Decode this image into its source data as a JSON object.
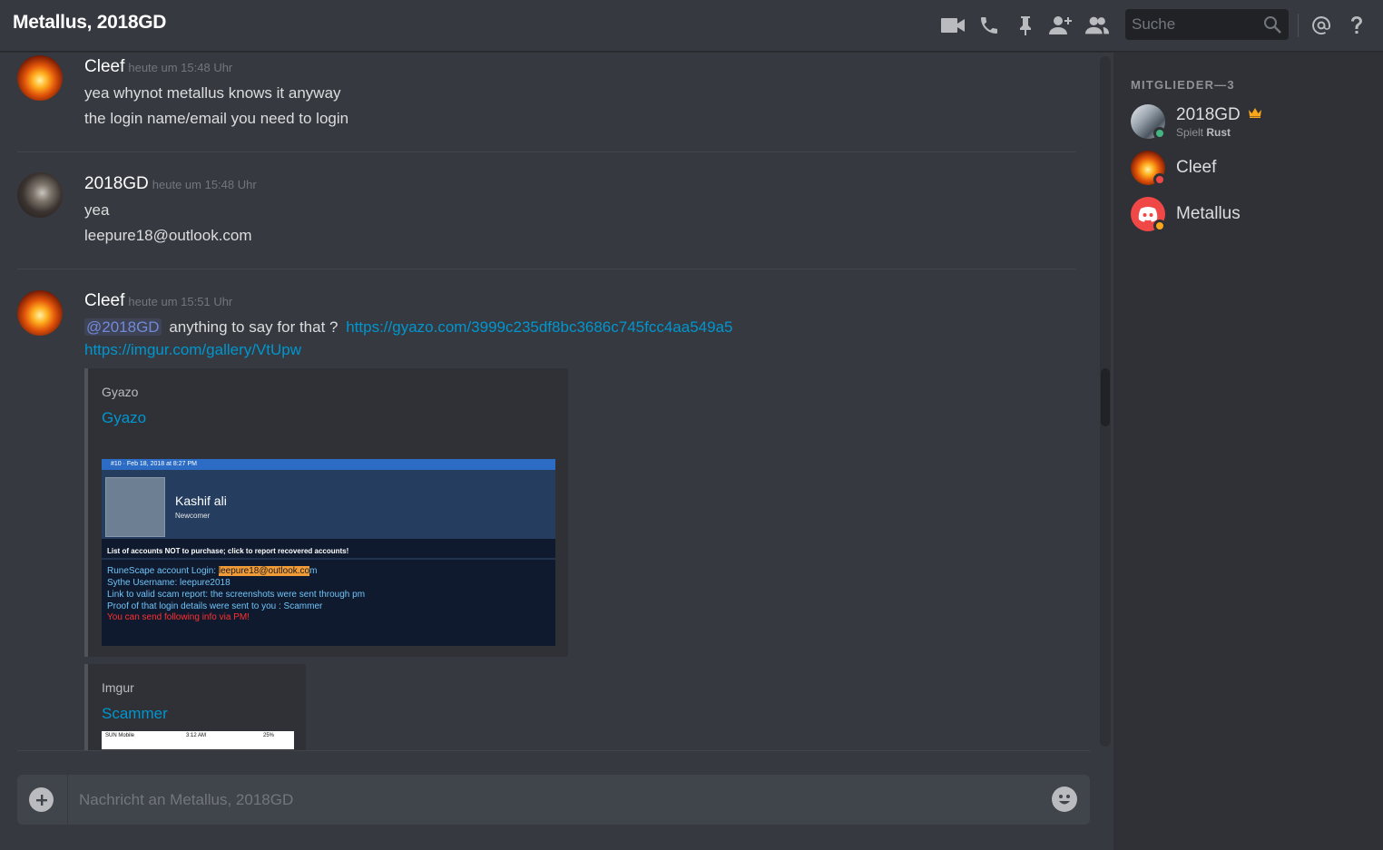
{
  "header": {
    "title": "Metallus, 2018GD",
    "search_placeholder": "Suche"
  },
  "messages": [
    {
      "author": "Cleef",
      "timestamp": "heute um 15:48 Uhr",
      "lines": [
        "yea whynot metallus knows it anyway",
        "the login name/email you need to login"
      ]
    },
    {
      "author": "2018GD",
      "timestamp": "heute um 15:48 Uhr",
      "lines": [
        "yea",
        "leepure18@outlook.com"
      ]
    },
    {
      "author": "Cleef",
      "timestamp": "heute um 15:51 Uhr",
      "mention": "@2018GD",
      "text": "anything to say for that ?",
      "link1": "https://gyazo.com/3999c235df8bc3686c745fcc4aa549a5",
      "link2": "https://imgur.com/gallery/VtUpw",
      "embeds": [
        {
          "provider": "Gyazo",
          "title": "Gyazo",
          "image": {
            "topbar": "#10 · Feb 18, 2018 at 8:27 PM",
            "name": "Kashif ali",
            "rank": "Newcomer",
            "heading": "List of accounts NOT to purchase; click to report recovered accounts!",
            "login_label": "RuneScape account Login:",
            "login_value": "leepure18@outlook.co",
            "login_tail": "m",
            "line2": "Sythe Username: leepure2018",
            "line3": "Link to valid scam report: the screenshots were sent through pm",
            "line4": "Proof of that login details were sent to you : Scammer",
            "line5": "You can send following info via PM!"
          }
        },
        {
          "provider": "Imgur",
          "title": "Scammer",
          "thumb": {
            "carrier": "SUN Mobile",
            "time": "3:12 AM",
            "battery": "25%"
          }
        }
      ]
    }
  ],
  "composer": {
    "placeholder": "Nachricht an Metallus, 2018GD"
  },
  "members": {
    "heading": "MITGLIEDER—3",
    "list": [
      {
        "name": "2018GD",
        "activity_prefix": "Spielt",
        "activity_game": "Rust",
        "owner": true,
        "status_color": "#43b581"
      },
      {
        "name": "Cleef",
        "status_color": "#f04747"
      },
      {
        "name": "Metallus",
        "status_color": "#faa61a"
      }
    ]
  }
}
